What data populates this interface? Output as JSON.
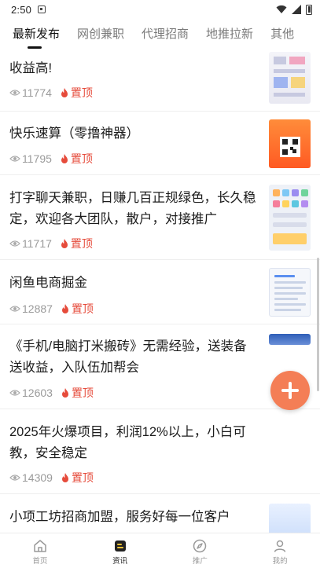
{
  "status_bar": {
    "time": "2:50"
  },
  "tabs": [
    {
      "label": "最新发布",
      "active": true
    },
    {
      "label": "网创兼职",
      "active": false
    },
    {
      "label": "代理招商",
      "active": false
    },
    {
      "label": "地推拉新",
      "active": false
    },
    {
      "label": "其他",
      "active": false
    }
  ],
  "items": [
    {
      "title_partial": "收益高!",
      "views": "11774",
      "pin": "置顶"
    },
    {
      "title": "快乐速算（零撸神器）",
      "views": "11795",
      "pin": "置顶"
    },
    {
      "title": "打字聊天兼职，日赚几百正规绿色，长久稳定，欢迎各大团队，散户，对接推广",
      "views": "11717",
      "pin": "置顶"
    },
    {
      "title": "闲鱼电商掘金",
      "views": "12887",
      "pin": "置顶"
    },
    {
      "title": "《手机/电脑打米搬砖》无需经验，送装备送收益，入队伍加帮会",
      "views": "12603",
      "pin": "置顶"
    },
    {
      "title": "2025年火爆项目，利润12%以上，小白可教，安全稳定",
      "views": "14309",
      "pin": "置顶"
    },
    {
      "title": "小项工坊招商加盟，服务好每一位客户",
      "views": "",
      "pin": ""
    }
  ],
  "bottom_nav": [
    {
      "label": "首页",
      "icon": "home-icon",
      "active": false
    },
    {
      "label": "资讯",
      "icon": "news-icon",
      "active": true
    },
    {
      "label": "推广",
      "icon": "compass-icon",
      "active": false
    },
    {
      "label": "我的",
      "icon": "user-icon",
      "active": false
    }
  ],
  "colors": {
    "accent": "#f47e56",
    "pin": "#e64b3b",
    "text": "#1c1c1c",
    "muted": "#9a9a9a"
  }
}
